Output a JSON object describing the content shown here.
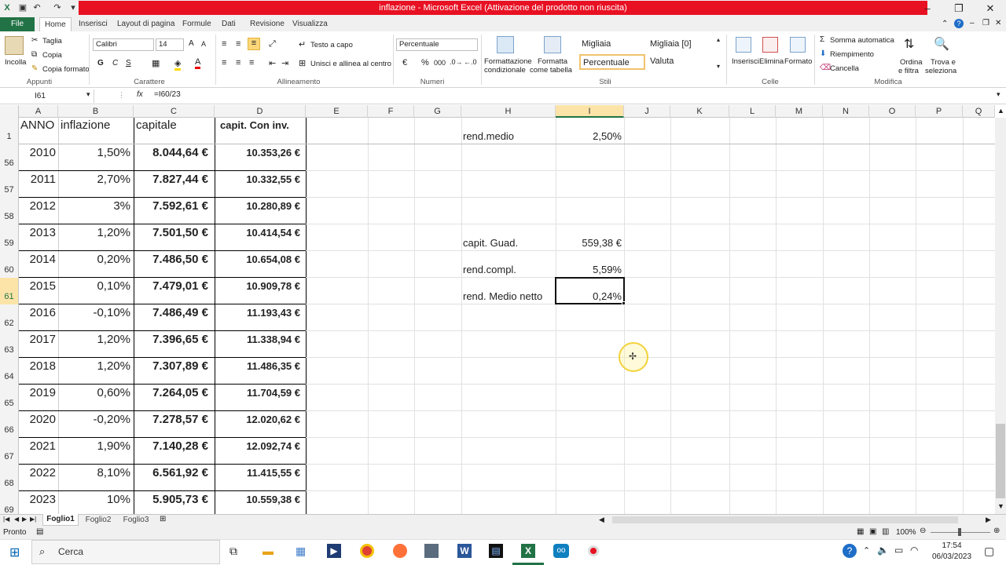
{
  "window": {
    "title": "inflazione - Microsoft Excel (Attivazione del prodotto non riuscita)",
    "accent": "#217346",
    "alert_color": "#e81123"
  },
  "ribbon_tabs": [
    "File",
    "Home",
    "Inserisci",
    "Layout di pagina",
    "Formule",
    "Dati",
    "Revisione",
    "Visualizza"
  ],
  "clipboard": {
    "paste": "Incolla",
    "cut": "Taglia",
    "copy": "Copia",
    "format_painter": "Copia formato",
    "group": "Appunti"
  },
  "font": {
    "name": "Calibri",
    "size": "14",
    "bold": "G",
    "italic": "C",
    "underline": "S",
    "group": "Carattere"
  },
  "alignment": {
    "wrap": "Testo a capo",
    "merge": "Unisci e allinea al centro",
    "group": "Allineamento"
  },
  "number": {
    "format": "Percentuale",
    "currency_symbol": "€",
    "percent_symbol": "%",
    "thousands_symbol": "000",
    "group": "Numeri"
  },
  "styles": {
    "cond_format": "Formattazione",
    "cond_format2": "condizionale",
    "table_format": "Formatta",
    "table_format2": "come tabella",
    "cells": [
      "Migliaia",
      "Migliaia [0]",
      "Percentuale",
      "Valuta"
    ],
    "group": "Stili"
  },
  "cells_group": {
    "insert": "Inserisci",
    "delete": "Elimina",
    "format": "Formato",
    "group": "Celle"
  },
  "editing": {
    "autosum": "Somma automatica",
    "fill": "Riempimento",
    "clear": "Cancella",
    "sort": "Ordina",
    "sort2": "e filtra",
    "find": "Trova e",
    "find2": "seleziona",
    "group": "Modifica"
  },
  "formula_bar": {
    "name_box": "I61",
    "fx": "fx",
    "formula": "=I60/23"
  },
  "columns": [
    "A",
    "B",
    "C",
    "D",
    "E",
    "F",
    "G",
    "H",
    "I",
    "J",
    "K",
    "L",
    "M",
    "N",
    "O",
    "P",
    "Q"
  ],
  "header_row": {
    "row": "1",
    "a": "ANNO",
    "b": "inflazione",
    "c": "capitale",
    "d": "capit. Con inv.",
    "h": "rend.medio",
    "i": "2,50%"
  },
  "rows": [
    {
      "row": "56",
      "year": "2010",
      "infl": "1,50%",
      "cap": "8.044,64 €",
      "inv": "10.353,26 €"
    },
    {
      "row": "57",
      "year": "2011",
      "infl": "2,70%",
      "cap": "7.827,44 €",
      "inv": "10.332,55 €"
    },
    {
      "row": "58",
      "year": "2012",
      "infl": "3%",
      "cap": "7.592,61 €",
      "inv": "10.280,89 €"
    },
    {
      "row": "59",
      "year": "2013",
      "infl": "1,20%",
      "cap": "7.501,50 €",
      "inv": "10.414,54 €",
      "h": "capit. Guad.",
      "i": "559,38 €"
    },
    {
      "row": "60",
      "year": "2014",
      "infl": "0,20%",
      "cap": "7.486,50 €",
      "inv": "10.654,08 €",
      "h": "rend.compl.",
      "i": "5,59%"
    },
    {
      "row": "61",
      "year": "2015",
      "infl": "0,10%",
      "cap": "7.479,01 €",
      "inv": "10.909,78 €",
      "h": "rend. Medio netto",
      "i": "0,24%"
    },
    {
      "row": "62",
      "year": "2016",
      "infl": "-0,10%",
      "cap": "7.486,49 €",
      "inv": "11.193,43 €"
    },
    {
      "row": "63",
      "year": "2017",
      "infl": "1,20%",
      "cap": "7.396,65 €",
      "inv": "11.338,94 €"
    },
    {
      "row": "64",
      "year": "2018",
      "infl": "1,20%",
      "cap": "7.307,89 €",
      "inv": "11.486,35 €"
    },
    {
      "row": "65",
      "year": "2019",
      "infl": "0,60%",
      "cap": "7.264,05 €",
      "inv": "11.704,59 €"
    },
    {
      "row": "66",
      "year": "2020",
      "infl": "-0,20%",
      "cap": "7.278,57 €",
      "inv": "12.020,62 €"
    },
    {
      "row": "67",
      "year": "2021",
      "infl": "1,90%",
      "cap": "7.140,28 €",
      "inv": "12.092,74 €"
    },
    {
      "row": "68",
      "year": "2022",
      "infl": "8,10%",
      "cap": "6.561,92 €",
      "inv": "11.415,55 €"
    },
    {
      "row": "69",
      "year": "2023",
      "infl": "10%",
      "cap": "5.905,73 €",
      "inv": "10.559,38 €"
    }
  ],
  "sheets": [
    "Foglio1",
    "Foglio2",
    "Foglio3"
  ],
  "status": {
    "ready": "Pronto",
    "zoom": "100%"
  },
  "taskbar": {
    "search": "Cerca",
    "time": "17:54",
    "date": "06/03/2023"
  }
}
